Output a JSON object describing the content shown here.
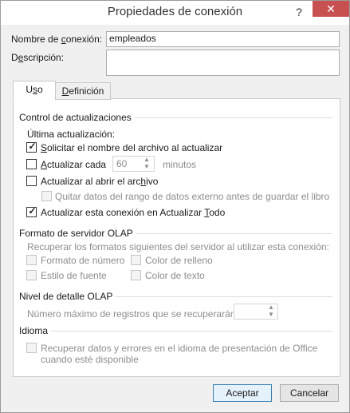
{
  "window": {
    "title": "Propiedades de conexión",
    "help_glyph": "?",
    "close_glyph": "✕"
  },
  "connection": {
    "name_label_pre": "Nombre de ",
    "name_label_acc": "c",
    "name_label_post": "onexión:",
    "name_value": "empleados",
    "desc_label_pre": "D",
    "desc_label_acc": "e",
    "desc_label_post": "scripción:",
    "desc_value": ""
  },
  "tabs": [
    {
      "pre": "U",
      "acc": "s",
      "post": "o"
    },
    {
      "pre": "",
      "acc": "D",
      "post": "efinición"
    }
  ],
  "control": {
    "title": "Control de actualizaciones",
    "last_update": "Última actualización:",
    "ask_file_pre": "",
    "ask_file_acc": "S",
    "ask_file_post": "olicitar el nombre del archivo al actualizar",
    "ask_file_checked": true,
    "refresh_every_pre": "",
    "refresh_every_acc": "A",
    "refresh_every_post": "ctualizar cada",
    "refresh_every_checked": false,
    "minutes_value": "60",
    "minutes_label": "minutos",
    "refresh_on_open_pre": "Actualizar al abrir el arc",
    "refresh_on_open_acc": "h",
    "refresh_on_open_post": "ivo",
    "refresh_on_open_checked": false,
    "remove_data": "Quitar datos del rango de datos externo antes de guardar el libro",
    "remove_data_checked": false,
    "refresh_all_pre": "Actualizar esta conexión en Actualizar ",
    "refresh_all_acc": "T",
    "refresh_all_post": "odo",
    "refresh_all_checked": true
  },
  "olap_format": {
    "title": "Formato de servidor OLAP",
    "description": "Recuperar los formatos siguientes del servidor al utilizar esta conexión:",
    "number_format": "Formato de número",
    "fill_color": "Color de relleno",
    "font_style": "Estilo de fuente",
    "text_color": "Color de texto"
  },
  "olap_detail": {
    "title": "Nivel de detalle OLAP",
    "max_records": "Número máximo de registros que se recuperarán:",
    "max_records_value": ""
  },
  "language": {
    "title": "Idioma",
    "retrieve_line1": "Recuperar datos y errores en el idioma de presentación de Office",
    "retrieve_line2": "cuando esté disponible"
  },
  "buttons": {
    "accept": "Aceptar",
    "cancel": "Cancelar"
  }
}
